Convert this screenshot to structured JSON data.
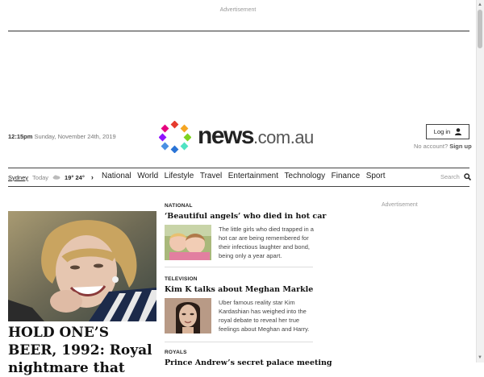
{
  "ads": {
    "top_label": "Advertisement",
    "right_label": "Advertisement"
  },
  "header": {
    "time": "12:15pm",
    "date": "Sunday, November 24th, 2019",
    "logo_main": "news",
    "logo_suffix": ".com.au",
    "login_label": "Log in",
    "account_prompt": "No account?",
    "signup_label": "Sign up"
  },
  "weather": {
    "city": "Sydney",
    "day": "Today",
    "low": "19°",
    "high": "24°"
  },
  "nav": {
    "items": [
      "National",
      "World",
      "Lifestyle",
      "Travel",
      "Entertainment",
      "Technology",
      "Finance",
      "Sport"
    ],
    "search_label": "Search"
  },
  "hero": {
    "title": "HOLD ONE’S BEER, 1992: Royal nightmare that"
  },
  "articles": [
    {
      "kicker": "NATIONAL",
      "title": "‘Beautiful angels’ who died in hot car",
      "summary": "The little girls who died trapped in a hot car are being remembered for their infectious laughter and bond, being only a year apart."
    },
    {
      "kicker": "TELEVISION",
      "title": "Kim K talks about Meghan Markle",
      "summary": "Uber famous reality star Kim Kardashian has weighed into the royal debate to reveal her true feelings about Meghan and Harry."
    },
    {
      "kicker": "ROYALS",
      "title": "Prince Andrew’s secret palace meeting"
    }
  ],
  "colors": {
    "logo_dots": [
      "#e63b2e",
      "#f5a623",
      "#7ed321",
      "#4a90e2",
      "#9013fe",
      "#50e3c2",
      "#2a74d6",
      "#e6007e"
    ]
  }
}
